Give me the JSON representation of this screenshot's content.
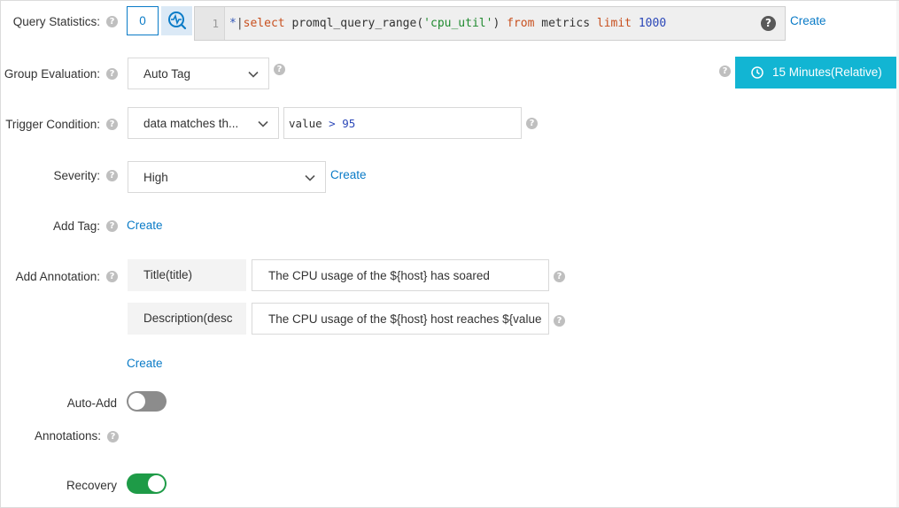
{
  "query_statistics": {
    "label": "Query Statistics:",
    "count": "0",
    "line_number": "1",
    "query": {
      "star": "*",
      "pipe": "|",
      "kw_select": "select",
      "func": "promql_query_range(",
      "arg": "'cpu_util'",
      "close": ")",
      "kw_from": "from",
      "table": "metrics",
      "kw_limit": "limit",
      "limit_value": "1000"
    },
    "create_link": "Create"
  },
  "group_evaluation": {
    "label": "Group Evaluation:",
    "selected": "Auto Tag",
    "time_range_button": "15 Minutes(Relative)"
  },
  "trigger_condition": {
    "label": "Trigger Condition:",
    "selected": "data matches th...",
    "expr_field": "value",
    "expr_op": ">",
    "expr_value": "95"
  },
  "severity": {
    "label": "Severity:",
    "selected": "High",
    "create_link": "Create"
  },
  "add_tag": {
    "label": "Add Tag:",
    "create_link": "Create"
  },
  "add_annotation": {
    "label": "Add Annotation:",
    "rows": [
      {
        "key": "Title(title)",
        "value": "The CPU usage of the ${host} has soared"
      },
      {
        "key": "Description(desc",
        "value": "The CPU usage of the ${host} host reaches ${value"
      }
    ],
    "create_link": "Create"
  },
  "auto_add_annotations": {
    "label_line1": "Auto-Add",
    "label_line2": "Annotations:",
    "enabled": false
  },
  "recovery": {
    "label": "Recovery",
    "enabled": true
  },
  "colors": {
    "accent": "#0a7bc7",
    "time_button_bg": "#12b5d3",
    "toggle_on": "#1e9b47",
    "toggle_off": "#8c8c8c"
  },
  "icons": {
    "help": "question-mark-circle",
    "dropdown": "chevron-down",
    "clock": "clock",
    "refresh": "refresh-chart"
  }
}
